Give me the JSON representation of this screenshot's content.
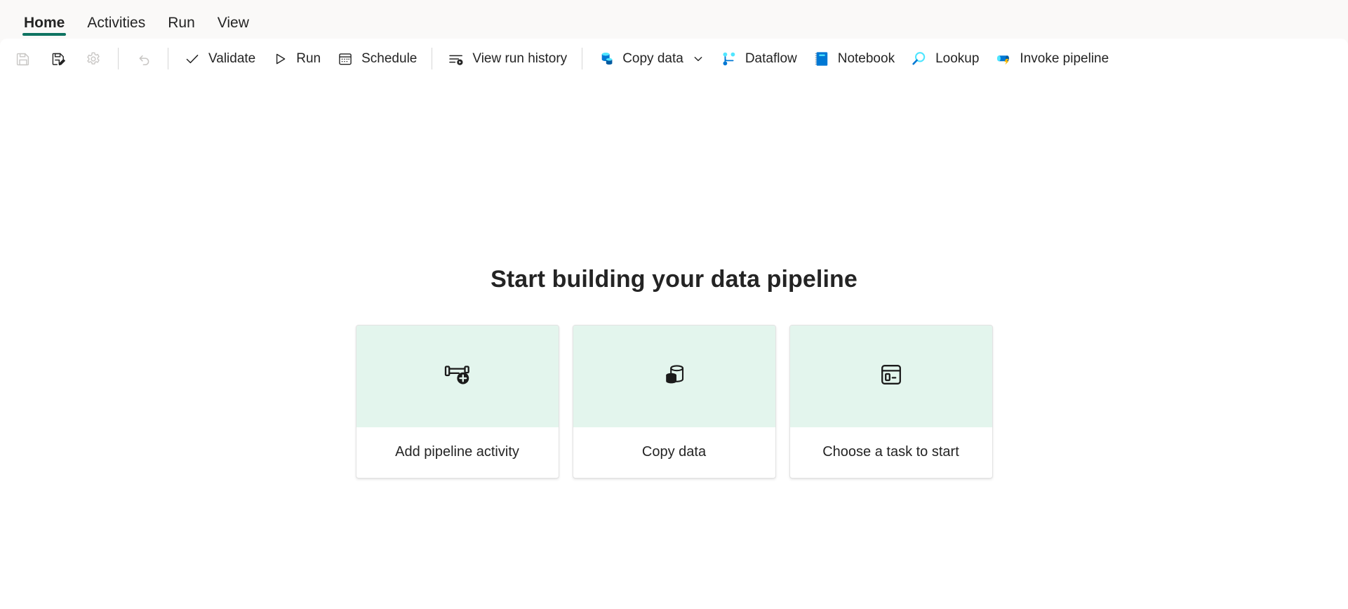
{
  "tabs": [
    {
      "label": "Home",
      "active": true,
      "name": "tab-home"
    },
    {
      "label": "Activities",
      "active": false,
      "name": "tab-activities"
    },
    {
      "label": "Run",
      "active": false,
      "name": "tab-run"
    },
    {
      "label": "View",
      "active": false,
      "name": "tab-view"
    }
  ],
  "colors": {
    "accent_teal": "#0f7361",
    "card_art_bg": "#e3f5ed",
    "toolbar_bg": "#ffffff",
    "tabstrip_bg": "#faf9f8",
    "text": "#242424",
    "disabled_text": "#bdbdbd",
    "fabric_blue": "#0078d4",
    "fabric_cyan": "#50e6ff",
    "fabric_yellow": "#ffb900"
  },
  "toolbar": {
    "items": [
      {
        "name": "save-button",
        "icon": "save-icon",
        "label": "",
        "disabled": true,
        "iconOnly": true
      },
      {
        "name": "save-as-button",
        "icon": "save-as-icon",
        "label": "",
        "disabled": false,
        "iconOnly": true
      },
      {
        "name": "settings-button",
        "icon": "gear-icon",
        "label": "",
        "disabled": true,
        "iconOnly": true
      },
      {
        "name": "separator-1",
        "icon": "separator",
        "label": "",
        "disabled": false,
        "iconOnly": false
      },
      {
        "name": "undo-button",
        "icon": "undo-icon",
        "label": "",
        "disabled": true,
        "iconOnly": true
      },
      {
        "name": "separator-2",
        "icon": "separator",
        "label": "",
        "disabled": false,
        "iconOnly": false
      },
      {
        "name": "validate-button",
        "icon": "checkmark-icon",
        "label": "Validate",
        "disabled": false,
        "iconOnly": false
      },
      {
        "name": "run-button",
        "icon": "play-icon",
        "label": "Run",
        "disabled": false,
        "iconOnly": false
      },
      {
        "name": "schedule-button",
        "icon": "calendar-icon",
        "label": "Schedule",
        "disabled": false,
        "iconOnly": false
      },
      {
        "name": "separator-3",
        "icon": "separator",
        "label": "",
        "disabled": false,
        "iconOnly": false
      },
      {
        "name": "view-run-history-button",
        "icon": "run-history-icon",
        "label": "View run history",
        "disabled": false,
        "iconOnly": false
      },
      {
        "name": "separator-4",
        "icon": "separator",
        "label": "",
        "disabled": false,
        "iconOnly": false
      },
      {
        "name": "copy-data-button",
        "icon": "copy-data-icon",
        "label": "Copy data",
        "disabled": false,
        "iconOnly": false,
        "hasChevron": true
      },
      {
        "name": "dataflow-button",
        "icon": "dataflow-icon",
        "label": "Dataflow",
        "disabled": false,
        "iconOnly": false
      },
      {
        "name": "notebook-button",
        "icon": "notebook-icon",
        "label": "Notebook",
        "disabled": false,
        "iconOnly": false
      },
      {
        "name": "lookup-button",
        "icon": "lookup-icon",
        "label": "Lookup",
        "disabled": false,
        "iconOnly": false
      },
      {
        "name": "invoke-pipeline-button",
        "icon": "invoke-pipeline-icon",
        "label": "Invoke pipeline",
        "disabled": false,
        "iconOnly": false
      }
    ]
  },
  "main": {
    "title": "Start building your data pipeline",
    "cards": [
      {
        "label": "Add pipeline activity",
        "icon": "add-pipeline-activity-icon",
        "name": "card-add-pipeline-activity"
      },
      {
        "label": "Copy data",
        "icon": "copy-data-card-icon",
        "name": "card-copy-data"
      },
      {
        "label": "Choose a task to start",
        "icon": "choose-task-icon",
        "name": "card-choose-task"
      }
    ]
  }
}
